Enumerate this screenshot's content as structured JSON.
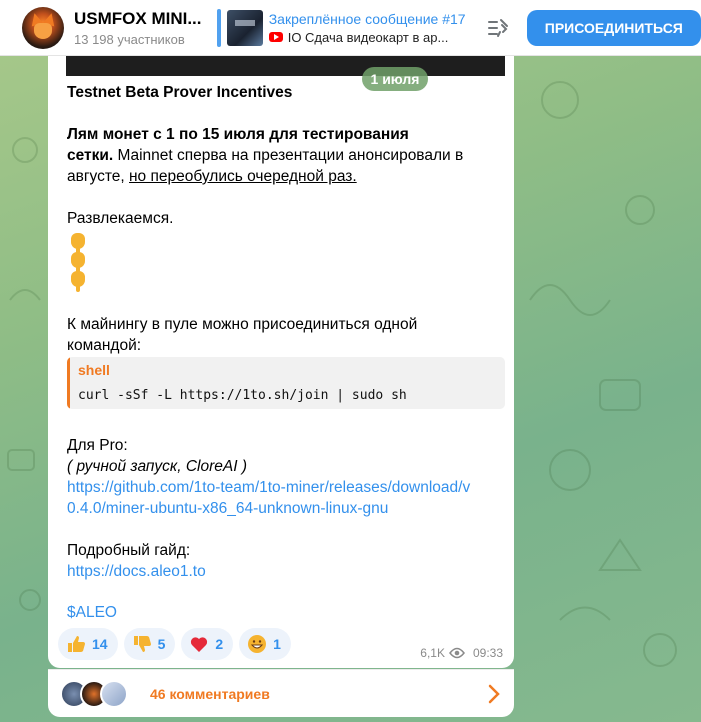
{
  "header": {
    "channel_title": "USMFOX MINI...",
    "members": "13 198 участников",
    "pinned_title": "Закреплённое сообщение #17",
    "pinned_preview": "IO Сдача видеокарт в ар...",
    "join_label": "ПРИСОЕДИНИТЬСЯ"
  },
  "message": {
    "date": "1 июля",
    "line1": "Testnet Beta Prover Incentives",
    "para2_bold_a": "Лям монет с 1 по 15 июля для тестирования",
    "para2_bold_b": "сетки.",
    "para2_rest_b": " Mainnet сперва на презентации анонсировали в",
    "para2_c_plain": "августе, ",
    "para2_c_underline": "но переобулись очередной раз.",
    "fun": "Развлекаемся.",
    "join_a": "К майнингу в пуле можно присоединиться одной",
    "join_b": "командой:",
    "code_lang": "shell",
    "code": "curl -sSf -L https://1to.sh/join | sudo sh",
    "pro": "Для Pro:",
    "pro_note": "( ручной запуск, CloreAI )",
    "pro_link_a": "https://github.com/1to-team/1to-miner/releases/download/v",
    "pro_link_b": "0.4.0/miner-ubuntu-x86_64-unknown-linux-gnu",
    "guide": "Подробный гайд:",
    "guide_link": "https://docs.aleo1.to",
    "tag": "$ALEO"
  },
  "reactions": [
    {
      "icon": "thumbs-up-icon",
      "count": "14"
    },
    {
      "icon": "thumbs-down-icon",
      "count": "5"
    },
    {
      "icon": "heart-icon",
      "count": "2"
    },
    {
      "icon": "grin-icon",
      "count": "1"
    }
  ],
  "meta": {
    "views": "6,1K",
    "time": "09:33"
  },
  "comments": {
    "label": "46 комментариев"
  },
  "colors": {
    "accent": "#3390ec",
    "quote": "#f07a22"
  }
}
